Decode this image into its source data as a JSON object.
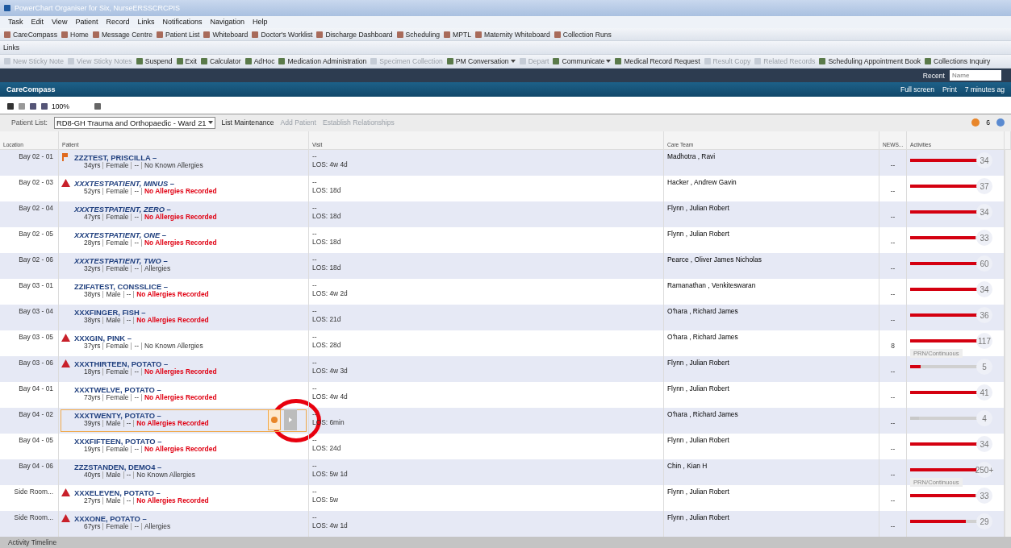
{
  "window": {
    "title": "PowerChart Organiser for Six, NurseERSSCRCPIS"
  },
  "menu": [
    "Task",
    "Edit",
    "View",
    "Patient",
    "Record",
    "Links",
    "Notifications",
    "Navigation",
    "Help"
  ],
  "toolbar": [
    {
      "label": "CareCompass",
      "disabled": false
    },
    {
      "label": "Home",
      "disabled": false
    },
    {
      "label": "Message Centre",
      "disabled": false
    },
    {
      "label": "Patient List",
      "disabled": false
    },
    {
      "label": "Whiteboard",
      "disabled": false
    },
    {
      "label": "Doctor's Worklist",
      "disabled": false
    },
    {
      "label": "Discharge Dashboard",
      "disabled": false
    },
    {
      "label": "Scheduling",
      "disabled": false
    },
    {
      "label": "MPTL",
      "disabled": false
    },
    {
      "label": "Maternity Whiteboard",
      "disabled": false
    },
    {
      "label": "Collection Runs",
      "disabled": false
    }
  ],
  "links_bar": {
    "label": "Links"
  },
  "toolbar2": [
    {
      "label": "New Sticky Note",
      "disabled": true
    },
    {
      "label": "View Sticky Notes",
      "disabled": true
    },
    {
      "label": "Suspend",
      "disabled": false
    },
    {
      "label": "Exit",
      "disabled": false
    },
    {
      "label": "Calculator",
      "disabled": false
    },
    {
      "label": "AdHoc",
      "disabled": false
    },
    {
      "label": "Medication Administration",
      "disabled": false
    },
    {
      "label": "Specimen Collection",
      "disabled": true
    },
    {
      "label": "PM Conversation",
      "disabled": false,
      "dropdown": true
    },
    {
      "label": "Depart",
      "disabled": true
    },
    {
      "label": "Communicate",
      "disabled": false,
      "dropdown": true
    },
    {
      "label": "Medical Record Request",
      "disabled": false
    },
    {
      "label": "Result Copy",
      "disabled": true
    },
    {
      "label": "Related Records",
      "disabled": true
    },
    {
      "label": "Scheduling Appointment Book",
      "disabled": false
    },
    {
      "label": "Collections Inquiry",
      "disabled": false
    }
  ],
  "search_bar": {
    "recent": "Recent",
    "placeholder": "Name"
  },
  "page": {
    "title": "CareCompass",
    "actions": [
      "Full screen",
      "Print",
      "7 minutes ag"
    ]
  },
  "zoom": {
    "value": "100%"
  },
  "patient_list": {
    "label": "Patient List:",
    "value": "RD8-GH Trauma and Orthopaedic - Ward 21",
    "actions": [
      {
        "label": "List Maintenance",
        "disabled": false
      },
      {
        "label": "Add Patient",
        "disabled": true
      },
      {
        "label": "Establish Relationships",
        "disabled": true
      }
    ],
    "alerts": "6"
  },
  "columns": [
    "Location",
    "Patient",
    "Visit",
    "Care Team",
    "NEWS...",
    "Activities"
  ],
  "rows": [
    {
      "location": "Bay 02 - 01",
      "kind": "flag",
      "name": "ZZZTEST, PRISCILLA –",
      "italic": false,
      "age": "34yrs",
      "sex": "Female",
      "code": "--",
      "allergies": "No Known Allergies",
      "allergy_alert": false,
      "visit": "--",
      "los": "LOS: 4w 4d",
      "care_team": "Madhotra , Ravi",
      "news": "--",
      "level": 0.94,
      "count": "34",
      "inactive": false,
      "selected": false
    },
    {
      "location": "Bay 02 - 03",
      "kind": "alert",
      "name": "XXXTESTPATIENT, MINUS –",
      "italic": true,
      "age": "52yrs",
      "sex": "Female",
      "code": "--",
      "allergies": "No Allergies Recorded",
      "allergy_alert": true,
      "visit": "--",
      "los": "LOS: 18d",
      "care_team": "Hacker , Andrew Gavin",
      "news": "--",
      "level": 0.97,
      "count": "37",
      "inactive": false,
      "selected": false
    },
    {
      "location": "Bay 02 - 04",
      "kind": "plain",
      "name": "XXXTESTPATIENT, ZERO –",
      "italic": true,
      "age": "47yrs",
      "sex": "Female",
      "code": "--",
      "allergies": "No Allergies Recorded",
      "allergy_alert": true,
      "visit": "--",
      "los": "LOS: 18d",
      "care_team": "Flynn , Julian Robert",
      "news": "--",
      "level": 0.94,
      "count": "34",
      "inactive": false,
      "selected": false
    },
    {
      "location": "Bay 02 - 05",
      "kind": "plain",
      "name": "XXXTESTPATIENT, ONE –",
      "italic": true,
      "age": "28yrs",
      "sex": "Female",
      "code": "--",
      "allergies": "No Allergies Recorded",
      "allergy_alert": true,
      "visit": "--",
      "los": "LOS: 18d",
      "care_team": "Flynn , Julian Robert",
      "news": "--",
      "level": 0.92,
      "count": "33",
      "inactive": false,
      "selected": false
    },
    {
      "location": "Bay 02 - 06",
      "kind": "plain",
      "name": "XXXTESTPATIENT, TWO –",
      "italic": true,
      "age": "32yrs",
      "sex": "Female",
      "code": "--",
      "allergies": "Allergies",
      "allergy_alert": false,
      "visit": "--",
      "los": "LOS: 18d",
      "care_team": "Pearce , Oliver James Nicholas",
      "news": "--",
      "level": 1,
      "count": "60",
      "inactive": false,
      "selected": false
    },
    {
      "location": "Bay 03 - 01",
      "kind": "plain",
      "name": "ZZIFATEST, CONSSLICE –",
      "italic": false,
      "age": "38yrs",
      "sex": "Male",
      "code": "--",
      "allergies": "No Allergies Recorded",
      "allergy_alert": true,
      "visit": "--",
      "los": "LOS: 4w 2d",
      "care_team": "Ramanathan , Venkiteswaran",
      "news": "--",
      "level": 0.97,
      "count": "34",
      "inactive": false,
      "selected": false
    },
    {
      "location": "Bay 03 - 04",
      "kind": "plain",
      "name": "XXXFINGER, FISH –",
      "italic": false,
      "age": "38yrs",
      "sex": "Male",
      "code": "--",
      "allergies": "No Allergies Recorded",
      "allergy_alert": true,
      "visit": "--",
      "los": "LOS: 21d",
      "care_team": "O'hara , Richard James",
      "news": "--",
      "level": 0.94,
      "count": "36",
      "inactive": false,
      "selected": false
    },
    {
      "location": "Bay 03 - 05",
      "kind": "alert",
      "name": "XXXGIN, PINK –",
      "italic": false,
      "age": "37yrs",
      "sex": "Female",
      "code": "--",
      "allergies": "No Known Allergies",
      "allergy_alert": false,
      "visit": "--",
      "los": "LOS: 28d",
      "care_team": "O'hara , Richard James",
      "news": "8",
      "level": 1,
      "count": "117",
      "prn": "PRN/Continuous",
      "inactive": false,
      "selected": false
    },
    {
      "location": "Bay 03 - 06",
      "kind": "alert",
      "name": "XXXTHIRTEEN, POTATO –",
      "italic": false,
      "age": "18yrs",
      "sex": "Female",
      "code": "--",
      "allergies": "No Allergies Recorded",
      "allergy_alert": true,
      "visit": "--",
      "los": "LOS: 4w 3d",
      "care_team": "Flynn , Julian Robert",
      "news": "--",
      "level": 0.15,
      "count": "5",
      "inactive": false,
      "selected": false
    },
    {
      "location": "Bay 04 - 01",
      "kind": "plain",
      "name": "XXXTWELVE, POTATO –",
      "italic": false,
      "age": "73yrs",
      "sex": "Female",
      "code": "--",
      "allergies": "No Allergies Recorded",
      "allergy_alert": true,
      "visit": "--",
      "los": "LOS: 4w 4d",
      "care_team": "Flynn , Julian Robert",
      "news": "--",
      "level": 1,
      "count": "41",
      "inactive": false,
      "selected": false
    },
    {
      "location": "Bay 04 - 02",
      "kind": "plain",
      "name": "XXXTWENTY, POTATO –",
      "italic": false,
      "age": "39yrs",
      "sex": "Male",
      "code": "--",
      "allergies": "No Allergies Recorded",
      "allergy_alert": true,
      "visit": "--",
      "los": "LOS: 6min",
      "care_team": "O'hara , Richard James",
      "news": "--",
      "level": 0.12,
      "count": "4",
      "inactive": true,
      "selected": true
    },
    {
      "location": "Bay 04 - 05",
      "kind": "plain",
      "name": "XXXFIFTEEN, POTATO –",
      "italic": false,
      "age": "19yrs",
      "sex": "Female",
      "code": "--",
      "allergies": "No Allergies Recorded",
      "allergy_alert": true,
      "visit": "--",
      "los": "LOS: 24d",
      "care_team": "Flynn , Julian Robert",
      "news": "--",
      "level": 0.97,
      "count": "34",
      "inactive": false,
      "selected": false
    },
    {
      "location": "Bay 04 - 06",
      "kind": "plain",
      "name": "ZZZSTANDEN, DEMO4 –",
      "italic": false,
      "age": "40yrs",
      "sex": "Male",
      "code": "--",
      "allergies": "No Known Allergies",
      "allergy_alert": false,
      "visit": "--",
      "los": "LOS: 5w 1d",
      "care_team": "Chin , Kian H",
      "news": "--",
      "level": 1,
      "count": "250+",
      "prn": "PRN/Continuous",
      "inactive": false,
      "selected": false
    },
    {
      "location": "Side Room...",
      "kind": "alert",
      "name": "XXXELEVEN, POTATO –",
      "italic": false,
      "age": "27yrs",
      "sex": "Male",
      "code": "--",
      "allergies": "No Allergies Recorded",
      "allergy_alert": true,
      "visit": "--",
      "los": "LOS: 5w",
      "care_team": "Flynn , Julian Robert",
      "news": "--",
      "level": 0.92,
      "count": "33",
      "inactive": false,
      "selected": false
    },
    {
      "location": "Side Room...",
      "kind": "alert",
      "name": "XXXONE, POTATO –",
      "italic": false,
      "age": "67yrs",
      "sex": "Female",
      "code": "--",
      "allergies": "Allergies",
      "allergy_alert": false,
      "visit": "--",
      "los": "LOS: 4w 1d",
      "care_team": "Flynn , Julian Robert",
      "news": "--",
      "level": 0.78,
      "count": "29",
      "inactive": false,
      "selected": false
    }
  ],
  "footer": {
    "label": "Activity Timeline"
  }
}
